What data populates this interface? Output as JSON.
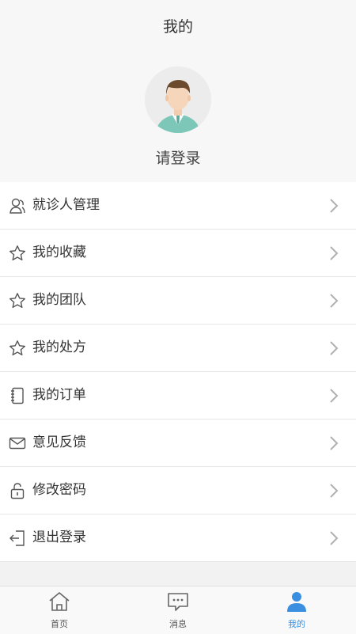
{
  "header": {
    "title": "我的",
    "login_text": "请登录"
  },
  "menu": {
    "items": [
      {
        "label": "就诊人管理",
        "icon": "patient-icon"
      },
      {
        "label": "我的收藏",
        "icon": "star-icon"
      },
      {
        "label": "我的团队",
        "icon": "star-icon"
      },
      {
        "label": "我的处方",
        "icon": "star-icon"
      },
      {
        "label": "我的订单",
        "icon": "notebook-icon"
      },
      {
        "label": "意见反馈",
        "icon": "mail-icon"
      },
      {
        "label": "修改密码",
        "icon": "lock-icon"
      },
      {
        "label": "退出登录",
        "icon": "logout-icon"
      }
    ]
  },
  "tabbar": {
    "tabs": [
      {
        "label": "首页",
        "icon": "home-icon",
        "active": false
      },
      {
        "label": "消息",
        "icon": "message-icon",
        "active": false
      },
      {
        "label": "我的",
        "icon": "person-icon",
        "active": true
      }
    ]
  },
  "colors": {
    "accent": "#3b8fe0",
    "icon_gray": "#555555",
    "chevron": "#b0b0b0",
    "avatar_shirt": "#7cc7b8"
  }
}
